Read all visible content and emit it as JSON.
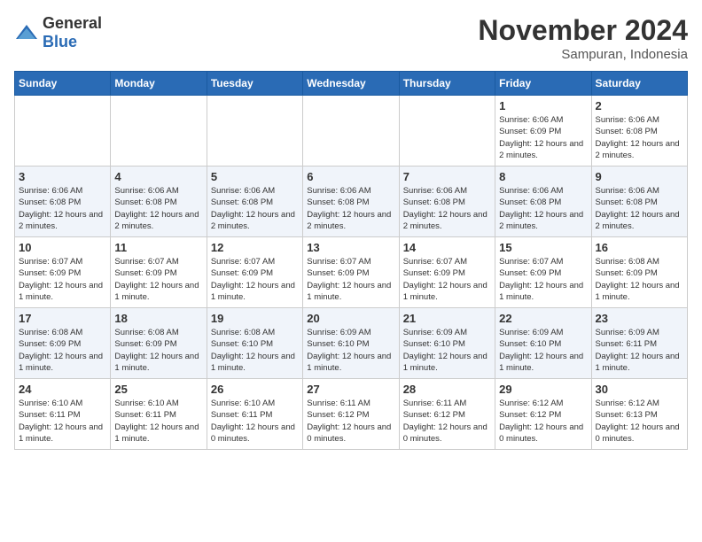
{
  "logo": {
    "text_general": "General",
    "text_blue": "Blue"
  },
  "header": {
    "month_year": "November 2024",
    "location": "Sampuran, Indonesia"
  },
  "weekdays": [
    "Sunday",
    "Monday",
    "Tuesday",
    "Wednesday",
    "Thursday",
    "Friday",
    "Saturday"
  ],
  "weeks": [
    [
      {
        "day": "",
        "info": ""
      },
      {
        "day": "",
        "info": ""
      },
      {
        "day": "",
        "info": ""
      },
      {
        "day": "",
        "info": ""
      },
      {
        "day": "",
        "info": ""
      },
      {
        "day": "1",
        "info": "Sunrise: 6:06 AM\nSunset: 6:09 PM\nDaylight: 12 hours and 2 minutes."
      },
      {
        "day": "2",
        "info": "Sunrise: 6:06 AM\nSunset: 6:08 PM\nDaylight: 12 hours and 2 minutes."
      }
    ],
    [
      {
        "day": "3",
        "info": "Sunrise: 6:06 AM\nSunset: 6:08 PM\nDaylight: 12 hours and 2 minutes."
      },
      {
        "day": "4",
        "info": "Sunrise: 6:06 AM\nSunset: 6:08 PM\nDaylight: 12 hours and 2 minutes."
      },
      {
        "day": "5",
        "info": "Sunrise: 6:06 AM\nSunset: 6:08 PM\nDaylight: 12 hours and 2 minutes."
      },
      {
        "day": "6",
        "info": "Sunrise: 6:06 AM\nSunset: 6:08 PM\nDaylight: 12 hours and 2 minutes."
      },
      {
        "day": "7",
        "info": "Sunrise: 6:06 AM\nSunset: 6:08 PM\nDaylight: 12 hours and 2 minutes."
      },
      {
        "day": "8",
        "info": "Sunrise: 6:06 AM\nSunset: 6:08 PM\nDaylight: 12 hours and 2 minutes."
      },
      {
        "day": "9",
        "info": "Sunrise: 6:06 AM\nSunset: 6:08 PM\nDaylight: 12 hours and 2 minutes."
      }
    ],
    [
      {
        "day": "10",
        "info": "Sunrise: 6:07 AM\nSunset: 6:09 PM\nDaylight: 12 hours and 1 minute."
      },
      {
        "day": "11",
        "info": "Sunrise: 6:07 AM\nSunset: 6:09 PM\nDaylight: 12 hours and 1 minute."
      },
      {
        "day": "12",
        "info": "Sunrise: 6:07 AM\nSunset: 6:09 PM\nDaylight: 12 hours and 1 minute."
      },
      {
        "day": "13",
        "info": "Sunrise: 6:07 AM\nSunset: 6:09 PM\nDaylight: 12 hours and 1 minute."
      },
      {
        "day": "14",
        "info": "Sunrise: 6:07 AM\nSunset: 6:09 PM\nDaylight: 12 hours and 1 minute."
      },
      {
        "day": "15",
        "info": "Sunrise: 6:07 AM\nSunset: 6:09 PM\nDaylight: 12 hours and 1 minute."
      },
      {
        "day": "16",
        "info": "Sunrise: 6:08 AM\nSunset: 6:09 PM\nDaylight: 12 hours and 1 minute."
      }
    ],
    [
      {
        "day": "17",
        "info": "Sunrise: 6:08 AM\nSunset: 6:09 PM\nDaylight: 12 hours and 1 minute."
      },
      {
        "day": "18",
        "info": "Sunrise: 6:08 AM\nSunset: 6:09 PM\nDaylight: 12 hours and 1 minute."
      },
      {
        "day": "19",
        "info": "Sunrise: 6:08 AM\nSunset: 6:10 PM\nDaylight: 12 hours and 1 minute."
      },
      {
        "day": "20",
        "info": "Sunrise: 6:09 AM\nSunset: 6:10 PM\nDaylight: 12 hours and 1 minute."
      },
      {
        "day": "21",
        "info": "Sunrise: 6:09 AM\nSunset: 6:10 PM\nDaylight: 12 hours and 1 minute."
      },
      {
        "day": "22",
        "info": "Sunrise: 6:09 AM\nSunset: 6:10 PM\nDaylight: 12 hours and 1 minute."
      },
      {
        "day": "23",
        "info": "Sunrise: 6:09 AM\nSunset: 6:11 PM\nDaylight: 12 hours and 1 minute."
      }
    ],
    [
      {
        "day": "24",
        "info": "Sunrise: 6:10 AM\nSunset: 6:11 PM\nDaylight: 12 hours and 1 minute."
      },
      {
        "day": "25",
        "info": "Sunrise: 6:10 AM\nSunset: 6:11 PM\nDaylight: 12 hours and 1 minute."
      },
      {
        "day": "26",
        "info": "Sunrise: 6:10 AM\nSunset: 6:11 PM\nDaylight: 12 hours and 0 minutes."
      },
      {
        "day": "27",
        "info": "Sunrise: 6:11 AM\nSunset: 6:12 PM\nDaylight: 12 hours and 0 minutes."
      },
      {
        "day": "28",
        "info": "Sunrise: 6:11 AM\nSunset: 6:12 PM\nDaylight: 12 hours and 0 minutes."
      },
      {
        "day": "29",
        "info": "Sunrise: 6:12 AM\nSunset: 6:12 PM\nDaylight: 12 hours and 0 minutes."
      },
      {
        "day": "30",
        "info": "Sunrise: 6:12 AM\nSunset: 6:13 PM\nDaylight: 12 hours and 0 minutes."
      }
    ]
  ]
}
